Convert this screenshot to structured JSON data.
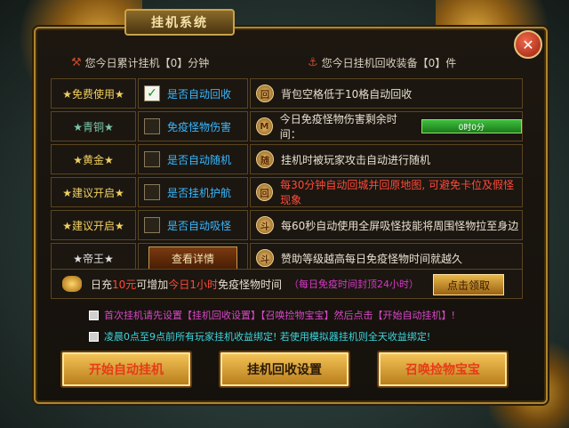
{
  "window": {
    "title": "挂机系统",
    "close_icon": "close-icon"
  },
  "stats": {
    "afk_minutes": "您今日累计挂机【0】分钟",
    "recycled_items": "您今日挂机回收装备【0】件"
  },
  "rows": [
    {
      "tier": "★免费使用★",
      "checked": true,
      "option": "是否自动回收",
      "icon": "回",
      "desc": "背包空格低于10格自动回收",
      "desc_color": "#e8e0d0"
    },
    {
      "tier": "★青铜★",
      "checked": false,
      "option": "免疫怪物伤害",
      "icon": "M",
      "desc": "今日免疫怪物伤害剩余时间：",
      "bar": "0时0分",
      "desc_color": "#e8e0d0"
    },
    {
      "tier": "★黄金★",
      "checked": false,
      "option": "是否自动随机",
      "icon": "随",
      "desc": "挂机时被玩家攻击自动进行随机",
      "desc_color": "#e8e0d0"
    },
    {
      "tier": "★建议开启★",
      "checked": false,
      "option": "是否挂机护航",
      "icon": "回",
      "desc": "每30分钟自动回城并回原地图, 可避免卡位及假怪现象",
      "desc_color": "#ff4a3a"
    },
    {
      "tier": "★建议开启★",
      "checked": false,
      "option": "是否自动吸怪",
      "icon": "斗",
      "desc": "每60秒自动使用全屏吸怪技能将周围怪物拉至身边",
      "desc_color": "#e8e0d0"
    },
    {
      "tier": "★帝王★",
      "checked": false,
      "option": "查看详情",
      "icon": "斗",
      "desc": "赞助等级越高每日免疫怪物时间就越久",
      "desc_color": "#e8e0d0",
      "is_button": true
    }
  ],
  "bonus": {
    "text1": "日充",
    "amount": "10元",
    "text2": "可增加",
    "highlight": "今日1小时",
    "text3": "免疫怪物时间",
    "limit": "（每日免疫时间封顶24小时）",
    "claim_label": "点击领取"
  },
  "notes": [
    "首次挂机请先设置【挂机回收设置】【召唤捡物宝宝】然后点击【开始自动挂机】!",
    "凌晨0点至9点前所有玩家挂机收益绑定! 若使用模拟器挂机则全天收益绑定!"
  ],
  "buttons": {
    "start": "开始自动挂机",
    "recycle": "挂机回收设置",
    "summon": "召唤捡物宝宝"
  }
}
